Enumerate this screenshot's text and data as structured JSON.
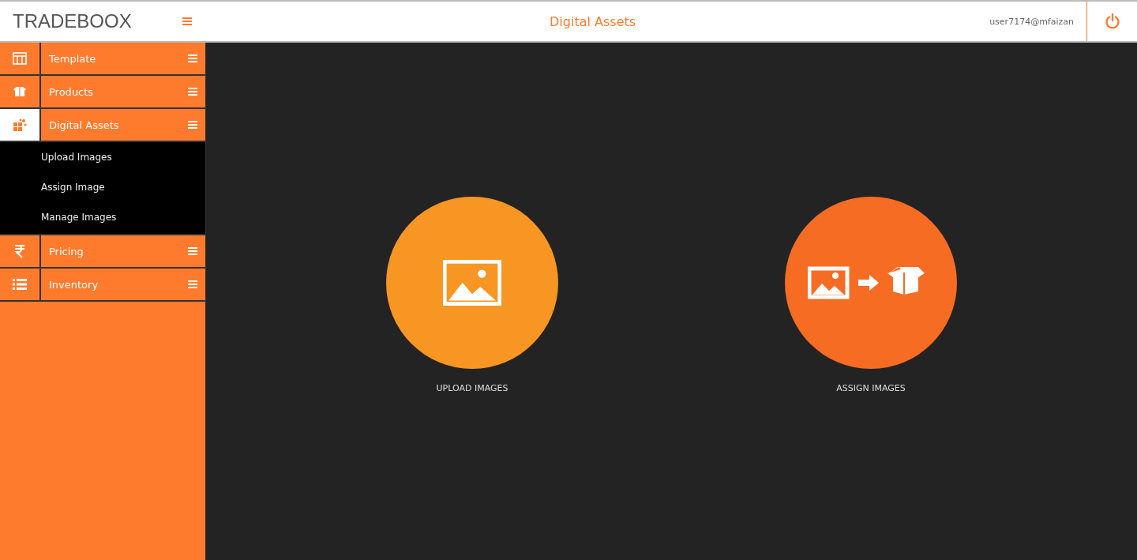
{
  "header": {
    "brand": "TRADEBOOX",
    "title": "Digital Assets",
    "user": "user7174@mfaizan"
  },
  "sidebar": {
    "items": [
      {
        "label": "Template",
        "expanded": false
      },
      {
        "label": "Products",
        "expanded": false
      },
      {
        "label": "Digital Assets",
        "expanded": true,
        "children": [
          "Upload Images",
          "Assign Image",
          "Manage Images"
        ]
      },
      {
        "label": "Pricing",
        "expanded": false
      },
      {
        "label": "Inventory",
        "expanded": false
      }
    ]
  },
  "tiles": [
    {
      "label": "UPLOAD IMAGES",
      "color": "#f79623"
    },
    {
      "label": "ASSIGN IMAGES",
      "color": "#f76c23"
    }
  ]
}
